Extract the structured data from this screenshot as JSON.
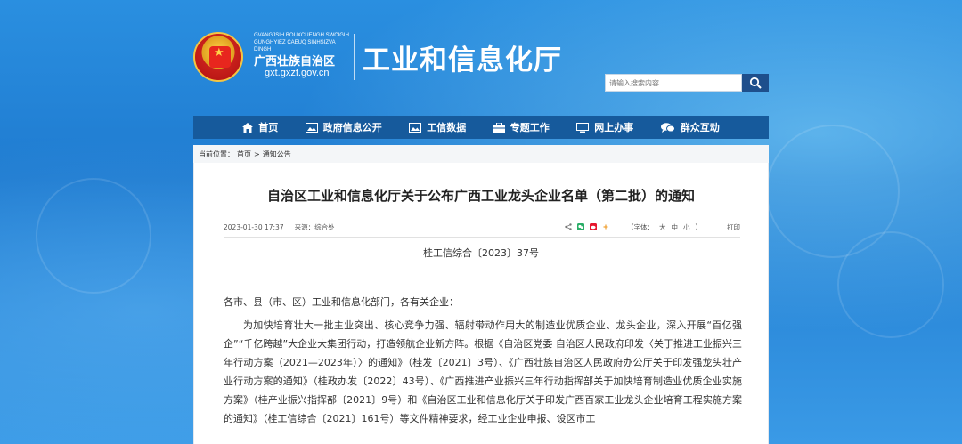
{
  "header": {
    "region_pinyin": "GVANGJSIH BOUXCUENGH SWCIGIH GUNGHYIEZ CAEUQ SINHSIZVA DINGH",
    "region_name": "广西壮族自治区",
    "region_url": "gxt.gxzf.gov.cn",
    "dept_title": "工业和信息化厅"
  },
  "search": {
    "placeholder": "请输入搜索内容"
  },
  "nav": {
    "items": [
      {
        "label": "首页",
        "icon": "home-icon"
      },
      {
        "label": "政府信息公开",
        "icon": "picture-icon"
      },
      {
        "label": "工信数据",
        "icon": "picture-icon"
      },
      {
        "label": "专题工作",
        "icon": "folder-icon"
      },
      {
        "label": "网上办事",
        "icon": "monitor-icon"
      },
      {
        "label": "群众互动",
        "icon": "chat-icon"
      }
    ]
  },
  "breadcrumb": {
    "prefix": "当前位置：",
    "home": "首页",
    "separator": ">",
    "current": "通知公告"
  },
  "article": {
    "title": "自治区工业和信息化厅关于公布广西工业龙头企业名单（第二批）的通知",
    "date": "2023-01-30 17:37",
    "source": "来源：综合处",
    "font_size_label": "【字体：",
    "font_big": "大",
    "font_mid": "中",
    "font_small": "小",
    "font_close": "】",
    "print": "打印",
    "doc_no": "桂工信综合〔2023〕37号",
    "salutation": "各市、县（市、区）工业和信息化部门，各有关企业：",
    "paragraph": "为加快培育壮大一批主业突出、核心竞争力强、辐射带动作用大的制造业优质企业、龙头企业，深入开展“百亿强企”“千亿跨越”大企业大集团行动，打造领航企业新方阵。根据《自治区党委 自治区人民政府印发〈关于推进工业振兴三年行动方案（2021—2023年）〉的通知》（桂发〔2021〕3号）、《广西壮族自治区人民政府办公厅关于印发强龙头壮产业行动方案的通知》（桂政办发〔2022〕43号）、《广西推进产业振兴三年行动指挥部关于加快培育制造业优质企业实施方案》（桂产业振兴指挥部〔2021〕9号）和《自治区工业和信息化厅关于印发广西百家工业龙头企业培育工程实施方案的通知》（桂工信综合〔2021〕161号）等文件精神要求，经工业企业申报、设区市工"
  },
  "colors": {
    "nav_bg": "#165a9c",
    "search_btn": "#1e4f8c",
    "page_bg": "#1f7fd0"
  }
}
